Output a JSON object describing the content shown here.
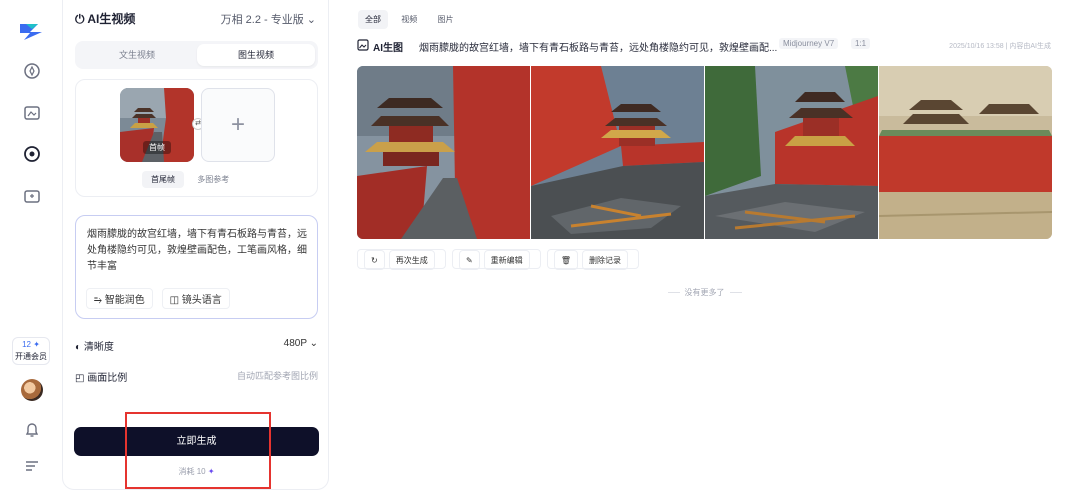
{
  "rail": {
    "icons": [
      "logo-icon",
      "inspiration-icon",
      "create-icon",
      "video-icon",
      "assets-icon",
      "bell-icon",
      "menu-icon"
    ],
    "member_count": "12",
    "member_label": "开通会员"
  },
  "panel": {
    "title": "AI生视频",
    "model": "万相 2.2 - 专业版",
    "mode_tabs": [
      "文生视频",
      "图生视频"
    ],
    "active_mode": "图生视频",
    "thumb_label": "首帧",
    "upload_tabs": [
      "首尾帧",
      "多图参考"
    ],
    "prompt": "烟雨朦胧的故宫红墙，墙下有青石板路与青苔，远处角楼隐约可见，敦煌壁画配色，工笔画风格，细节丰富",
    "chips": [
      "智能润色",
      "镜头语言"
    ],
    "clarity_label": "清晰度",
    "clarity_value": "480P",
    "ratio_label": "画面比例",
    "ratio_value": "自动匹配参考图比例",
    "generate_label": "立即生成",
    "cost_label": "消耗",
    "cost_value": "10"
  },
  "content": {
    "filter_tabs": [
      "全部",
      "视频",
      "图片"
    ],
    "record": {
      "kind": "AI生图",
      "description": "烟雨朦胧的故宫红墙，墙下有青石板路与青苔，远处角楼隐约可见，敦煌壁画配...",
      "model_tag": "Midjourney V7",
      "ratio_tag": "1:1",
      "meta": "2025/10/16 13:58 | 内容由AI生成"
    },
    "actions": [
      "再次生成",
      "重新编辑",
      "删除记录"
    ],
    "no_more": "没有更多了"
  },
  "colors": {
    "accent": "#3b6cf0",
    "primary_button": "#0e1029",
    "highlight_box": "#e5342f",
    "wall_red": "#c0392b"
  }
}
